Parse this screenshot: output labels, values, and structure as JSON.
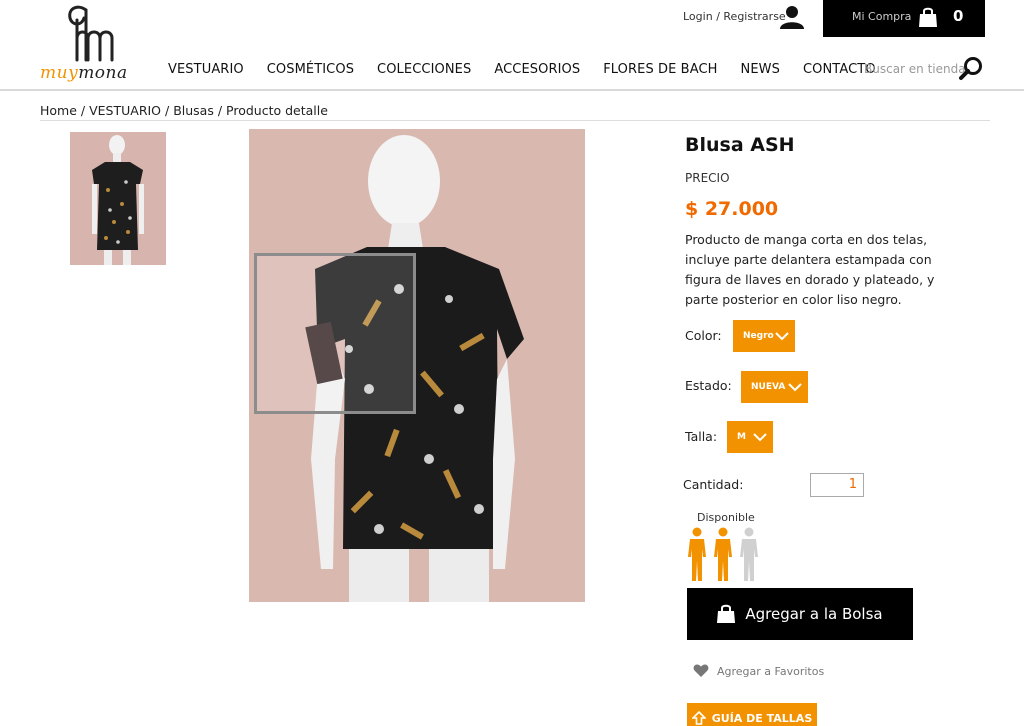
{
  "brand": {
    "name_part1": "muy",
    "name_part2": "mona"
  },
  "header": {
    "login_label": "Login",
    "separator": "/",
    "register_label": "Registrarse",
    "cart_label": "Mi Compra",
    "cart_count": "0",
    "search_placeholder": "Buscar en tienda"
  },
  "nav": {
    "items": [
      "VESTUARIO",
      "COSMÉTICOS",
      "COLECCIONES",
      "ACCESORIOS",
      "FLORES DE BACH",
      "NEWS",
      "CONTACTO"
    ]
  },
  "breadcrumb": {
    "items": [
      "Home",
      "VESTUARIO",
      "Blusas",
      "Producto detalle"
    ],
    "separator": " / "
  },
  "product": {
    "title": "Blusa ASH",
    "price_label": "PRECIO",
    "price": "$ 27.000",
    "description": "Producto de manga corta en dos telas, incluye parte delantera estampada con figura de llaves en dorado y plateado, y parte posterior en color liso negro.",
    "color_label": "Color:",
    "color_value": "Negro",
    "estado_label": "Estado:",
    "estado_value": "NUEVA",
    "talla_label": "Talla:",
    "talla_value": "M",
    "qty_label": "Cantidad:",
    "qty_value": "1",
    "availability_label": "Disponible",
    "availability_level": 2,
    "availability_max": 3,
    "add_to_bag": "Agregar a la Bolsa",
    "favorites": "Agregar a Favoritos",
    "size_guide": "GUÍA DE TALLAS"
  },
  "colors": {
    "accent": "#f39200",
    "price": "#f06a00",
    "dark": "#000000"
  }
}
